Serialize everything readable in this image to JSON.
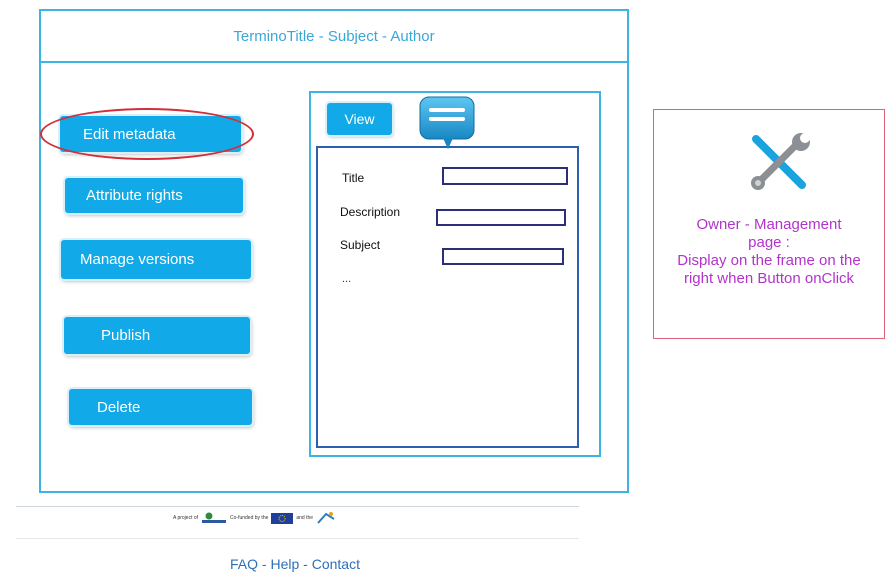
{
  "header": {
    "title": "TerminoTitle - Subject - Author"
  },
  "sidebar": {
    "buttons": [
      {
        "label": "Edit metadata"
      },
      {
        "label": "Attribute rights"
      },
      {
        "label": "Manage versions"
      },
      {
        "label": "Publish"
      },
      {
        "label": "Delete"
      }
    ]
  },
  "view": {
    "button_label": "View",
    "fields": [
      {
        "label": "Title",
        "value": ""
      },
      {
        "label": "Description",
        "value": ""
      },
      {
        "label": "Subject",
        "value": ""
      }
    ],
    "more": "..."
  },
  "annotation": {
    "text_line1": "Owner - Management",
    "text_line2": "page :",
    "text_line3": "Display on the frame on the",
    "text_line4": "right when Button onClick",
    "icon": "tools-icon",
    "color": "#b233cc"
  },
  "footer": {
    "project_text": "A project of",
    "cofunded_text": "Co-funded by the",
    "and_text": "and the",
    "links": "FAQ - Help - Contact"
  },
  "colors": {
    "frame": "#3db4e6",
    "button": "#12a9e8",
    "highlight": "#d0303a",
    "panel_border": "#2d5fae"
  }
}
